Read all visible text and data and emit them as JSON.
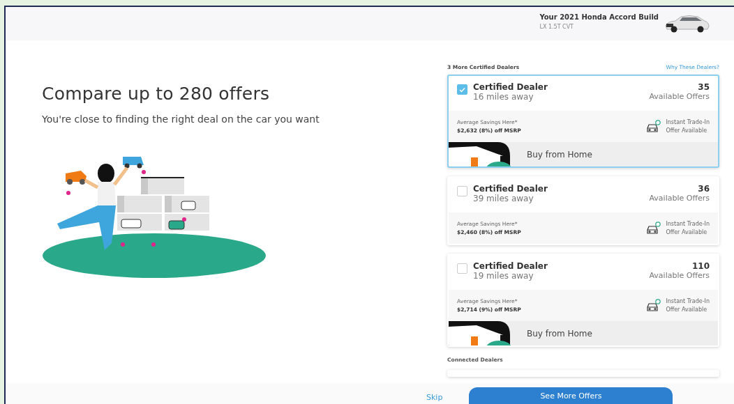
{
  "header": {
    "build_title": "Your 2021 Honda Accord Build",
    "trim": "LX 1.5T CVT"
  },
  "hero": {
    "title": "Compare up to 280 offers",
    "subtitle": "You're close to finding the right deal on the car you want"
  },
  "dealers_section": {
    "heading": "3 More Certified Dealers",
    "link": "Why These Dealers?"
  },
  "dealers": [
    {
      "checked": true,
      "name": "Certified Dealer",
      "distance": "16 miles away",
      "offers_count": "35",
      "offers_label": "Available Offers",
      "savings_label": "Average Savings Here*",
      "savings_value": "$2,632 (8%) off MSRP",
      "trade_in_line_1": "Instant Trade-In",
      "trade_in_line_2": "Offer Available",
      "buy_from_home": "Buy from Home"
    },
    {
      "checked": false,
      "name": "Certified Dealer",
      "distance": "39 miles away",
      "offers_count": "36",
      "offers_label": "Available Offers",
      "savings_label": "Average Savings Here*",
      "savings_value": "$2,460 (8%) off MSRP",
      "trade_in_line_1": "Instant Trade-In",
      "trade_in_line_2": "Offer Available"
    },
    {
      "checked": false,
      "name": "Certified Dealer",
      "distance": "19 miles away",
      "offers_count": "110",
      "offers_label": "Available Offers",
      "savings_label": "Average Savings Here*",
      "savings_value": "$2,714 (9%) off MSRP",
      "trade_in_line_1": "Instant Trade-In",
      "trade_in_line_2": "Offer Available",
      "buy_from_home": "Buy from Home"
    }
  ],
  "connected_section": {
    "heading": "Connected Dealers"
  },
  "footer": {
    "skip": "Skip",
    "primary_button": "See More Offers"
  }
}
